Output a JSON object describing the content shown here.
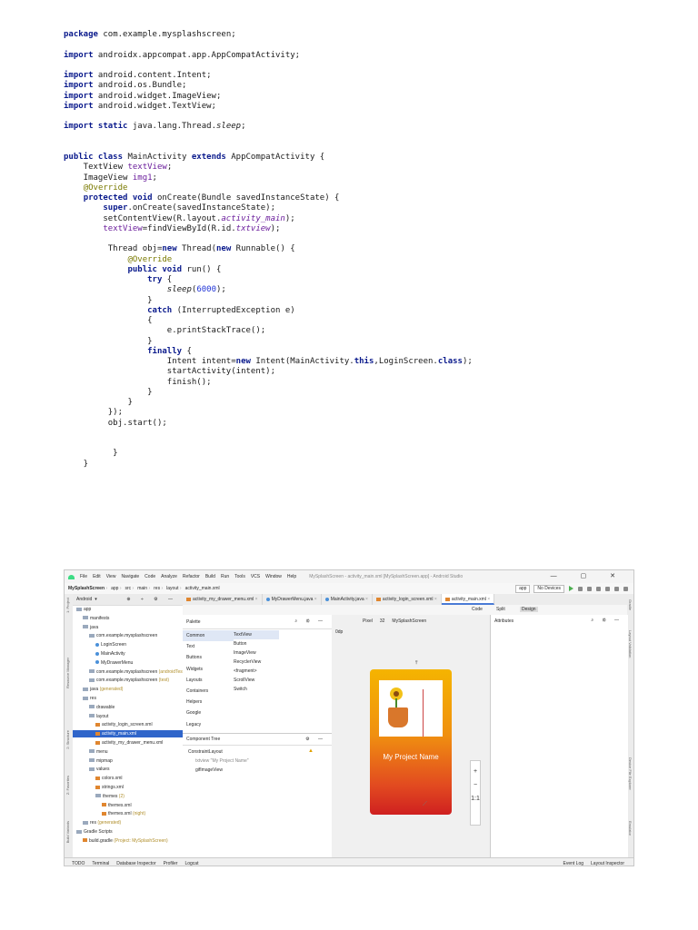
{
  "code_lines": [
    [
      [
        "package",
        "kw"
      ],
      [
        " com.example.mysplashscreen;",
        ""
      ]
    ],
    [],
    [
      [
        "import",
        "kw"
      ],
      [
        " androidx.appcompat.app.AppCompatActivity;",
        ""
      ]
    ],
    [],
    [
      [
        "import",
        "kw"
      ],
      [
        " android.content.Intent;",
        ""
      ]
    ],
    [
      [
        "import",
        "kw"
      ],
      [
        " android.os.Bundle;",
        ""
      ]
    ],
    [
      [
        "import",
        "kw"
      ],
      [
        " android.widget.ImageView;",
        ""
      ]
    ],
    [
      [
        "import",
        "kw"
      ],
      [
        " android.widget.TextView;",
        ""
      ]
    ],
    [],
    [
      [
        "import static",
        "kw"
      ],
      [
        " java.lang.Thread.",
        ""
      ],
      [
        "sleep",
        "it"
      ],
      [
        ";",
        ""
      ]
    ],
    [],
    [],
    [
      [
        "public class",
        "kw"
      ],
      [
        " MainActivity ",
        ""
      ],
      [
        "extends",
        "kw"
      ],
      [
        " AppCompatActivity {",
        ""
      ]
    ],
    [
      [
        "    TextView ",
        ""
      ],
      [
        "textView",
        "fld"
      ],
      [
        ";",
        ""
      ]
    ],
    [
      [
        "    ImageView ",
        ""
      ],
      [
        "img1",
        "fld"
      ],
      [
        ";",
        ""
      ]
    ],
    [
      [
        "    ",
        ""
      ],
      [
        "@Override",
        "ann"
      ]
    ],
    [
      [
        "    ",
        ""
      ],
      [
        "protected void",
        "kw"
      ],
      [
        " onCreate(Bundle savedInstanceState) {",
        ""
      ]
    ],
    [
      [
        "        ",
        ""
      ],
      [
        "super",
        "kw"
      ],
      [
        ".onCreate(savedInstanceState);",
        ""
      ]
    ],
    [
      [
        "        setContentView(R.layout.",
        ""
      ],
      [
        "activity_main",
        "fld it"
      ],
      [
        ");",
        ""
      ]
    ],
    [
      [
        "        ",
        ""
      ],
      [
        "textView",
        "fld"
      ],
      [
        "=findViewById(R.id.",
        ""
      ],
      [
        "txtview",
        "fld it"
      ],
      [
        ");",
        ""
      ]
    ],
    [],
    [
      [
        "         Thread obj=",
        ""
      ],
      [
        "new",
        "kw"
      ],
      [
        " Thread(",
        ""
      ],
      [
        "new",
        "kw"
      ],
      [
        " Runnable() {",
        ""
      ]
    ],
    [
      [
        "             ",
        ""
      ],
      [
        "@Override",
        "ann"
      ]
    ],
    [
      [
        "             ",
        ""
      ],
      [
        "public void",
        "kw"
      ],
      [
        " run() {",
        ""
      ]
    ],
    [
      [
        "                 ",
        ""
      ],
      [
        "try",
        "kw"
      ],
      [
        " {",
        ""
      ]
    ],
    [
      [
        "                     ",
        ""
      ],
      [
        "sleep",
        "it"
      ],
      [
        "(",
        ""
      ],
      [
        "6000",
        "num"
      ],
      [
        ");",
        ""
      ]
    ],
    [
      [
        "                 }",
        ""
      ]
    ],
    [
      [
        "                 ",
        ""
      ],
      [
        "catch",
        "kw"
      ],
      [
        " (InterruptedException e)",
        ""
      ]
    ],
    [
      [
        "                 {",
        ""
      ]
    ],
    [
      [
        "                     e.printStackTrace();",
        ""
      ]
    ],
    [
      [
        "                 }",
        ""
      ]
    ],
    [
      [
        "                 ",
        ""
      ],
      [
        "finally",
        "kw"
      ],
      [
        " {",
        ""
      ]
    ],
    [
      [
        "                     Intent intent=",
        ""
      ],
      [
        "new",
        "kw"
      ],
      [
        " Intent(MainActivity.",
        ""
      ],
      [
        "this",
        "kw"
      ],
      [
        ",LoginScreen.",
        ""
      ],
      [
        "class",
        "kw"
      ],
      [
        ");",
        ""
      ]
    ],
    [
      [
        "                     startActivity(intent);",
        ""
      ]
    ],
    [
      [
        "                     finish();",
        ""
      ]
    ],
    [
      [
        "                 }",
        ""
      ]
    ],
    [
      [
        "             }",
        ""
      ]
    ],
    [
      [
        "         });",
        ""
      ]
    ],
    [
      [
        "         obj.start();",
        ""
      ]
    ],
    [],
    [],
    [
      [
        "          }",
        ""
      ]
    ],
    [
      [
        "    }",
        ""
      ]
    ]
  ],
  "ide": {
    "menu": [
      "File",
      "Edit",
      "View",
      "Navigate",
      "Code",
      "Analyze",
      "Refactor",
      "Build",
      "Run",
      "Tools",
      "VCS",
      "Window",
      "Help"
    ],
    "window_title": "MySplashScreen - activity_main.xml [MySplashScreen.app] - Android Studio",
    "breadcrumbs": [
      "MySplashScreen",
      "app",
      "src",
      "main",
      "res",
      "layout",
      "activity_main.xml"
    ],
    "run_config": "app",
    "device": "No Devices",
    "project_view": "Android",
    "tree": [
      {
        "label": "app",
        "indent": 0,
        "icon": "folder"
      },
      {
        "label": "manifests",
        "indent": 1,
        "icon": "folder"
      },
      {
        "label": "java",
        "indent": 1,
        "icon": "folder"
      },
      {
        "label": "com.example.mysplashscreen",
        "indent": 2,
        "icon": "folder"
      },
      {
        "label": "LoginScreen",
        "indent": 3,
        "icon": "class"
      },
      {
        "label": "MainActivity",
        "indent": 3,
        "icon": "class"
      },
      {
        "label": "MyDrawerMenu",
        "indent": 3,
        "icon": "class"
      },
      {
        "label": "com.example.mysplashscreen",
        "indent": 2,
        "icon": "folder",
        "note": "(androidTest)"
      },
      {
        "label": "com.example.mysplashscreen",
        "indent": 2,
        "icon": "folder",
        "note": "(test)"
      },
      {
        "label": "java",
        "indent": 1,
        "icon": "folder",
        "note": "(generated)"
      },
      {
        "label": "res",
        "indent": 1,
        "icon": "folder"
      },
      {
        "label": "drawable",
        "indent": 2,
        "icon": "folder"
      },
      {
        "label": "layout",
        "indent": 2,
        "icon": "folder"
      },
      {
        "label": "activity_login_screen.xml",
        "indent": 3,
        "icon": "xml"
      },
      {
        "label": "activity_main.xml",
        "indent": 3,
        "icon": "xml",
        "selected": true
      },
      {
        "label": "activity_my_drawer_menu.xml",
        "indent": 3,
        "icon": "xml"
      },
      {
        "label": "menu",
        "indent": 2,
        "icon": "folder"
      },
      {
        "label": "mipmap",
        "indent": 2,
        "icon": "folder"
      },
      {
        "label": "values",
        "indent": 2,
        "icon": "folder"
      },
      {
        "label": "colors.xml",
        "indent": 3,
        "icon": "xml"
      },
      {
        "label": "strings.xml",
        "indent": 3,
        "icon": "xml"
      },
      {
        "label": "themes",
        "indent": 3,
        "icon": "folder",
        "note": "(2)"
      },
      {
        "label": "themes.xml",
        "indent": 4,
        "icon": "xml"
      },
      {
        "label": "themes.xml",
        "indent": 4,
        "icon": "xml",
        "note": "(night)"
      },
      {
        "label": "res",
        "indent": 1,
        "icon": "folder",
        "note": "(generated)"
      },
      {
        "label": "Gradle Scripts",
        "indent": 0,
        "icon": "folder"
      },
      {
        "label": "build.gradle",
        "indent": 1,
        "icon": "xml",
        "note": "(Project: MySplashScreen)"
      }
    ],
    "editor_tabs": [
      {
        "label": "activity_my_drawer_menu.xml",
        "active": false
      },
      {
        "label": "MyDrawerMenu.java",
        "active": false
      },
      {
        "label": "MainActivity.java",
        "active": false
      },
      {
        "label": "activity_login_screen.xml",
        "active": false
      },
      {
        "label": "activity_main.xml",
        "active": true
      }
    ],
    "modes": [
      "Code",
      "Split",
      "Design"
    ],
    "palette_title": "Palette",
    "palette_categories": [
      "Common",
      "Text",
      "Buttons",
      "Widgets",
      "Layouts",
      "Containers",
      "Helpers",
      "Google",
      "Legacy"
    ],
    "palette_items": [
      "TextView",
      "Button",
      "ImageView",
      "RecyclerView",
      "<fragment>",
      "ScrollView",
      "Switch"
    ],
    "component_tree_title": "Component Tree",
    "component_tree": [
      {
        "label": "ConstraintLayout",
        "indent": 0
      },
      {
        "label": "txtview  \"My Project Name\"",
        "indent": 1
      },
      {
        "label": "gifImageView",
        "indent": 1
      }
    ],
    "design_toolbar": [
      "Pixel",
      "32",
      "MySplashScreen"
    ],
    "design_zoom": [
      "0dp"
    ],
    "attributes_title": "Attributes",
    "phone_text": "My Project Name",
    "zoom_controls": [
      "+",
      "−",
      "1:1"
    ],
    "status_left": [
      "TODO",
      "Terminal",
      "Database Inspector",
      "Profiler",
      "Logcat"
    ],
    "status_right": [
      "Event Log",
      "Layout Inspector"
    ],
    "left_tool_tabs": [
      "1: Project",
      "Resource Manager",
      "2: Structure",
      "Z: Favorites",
      "Build Variants"
    ],
    "right_tool_tabs": [
      "Gradle",
      "Layout Validation",
      "Device File Explorer",
      "Emulator"
    ]
  }
}
